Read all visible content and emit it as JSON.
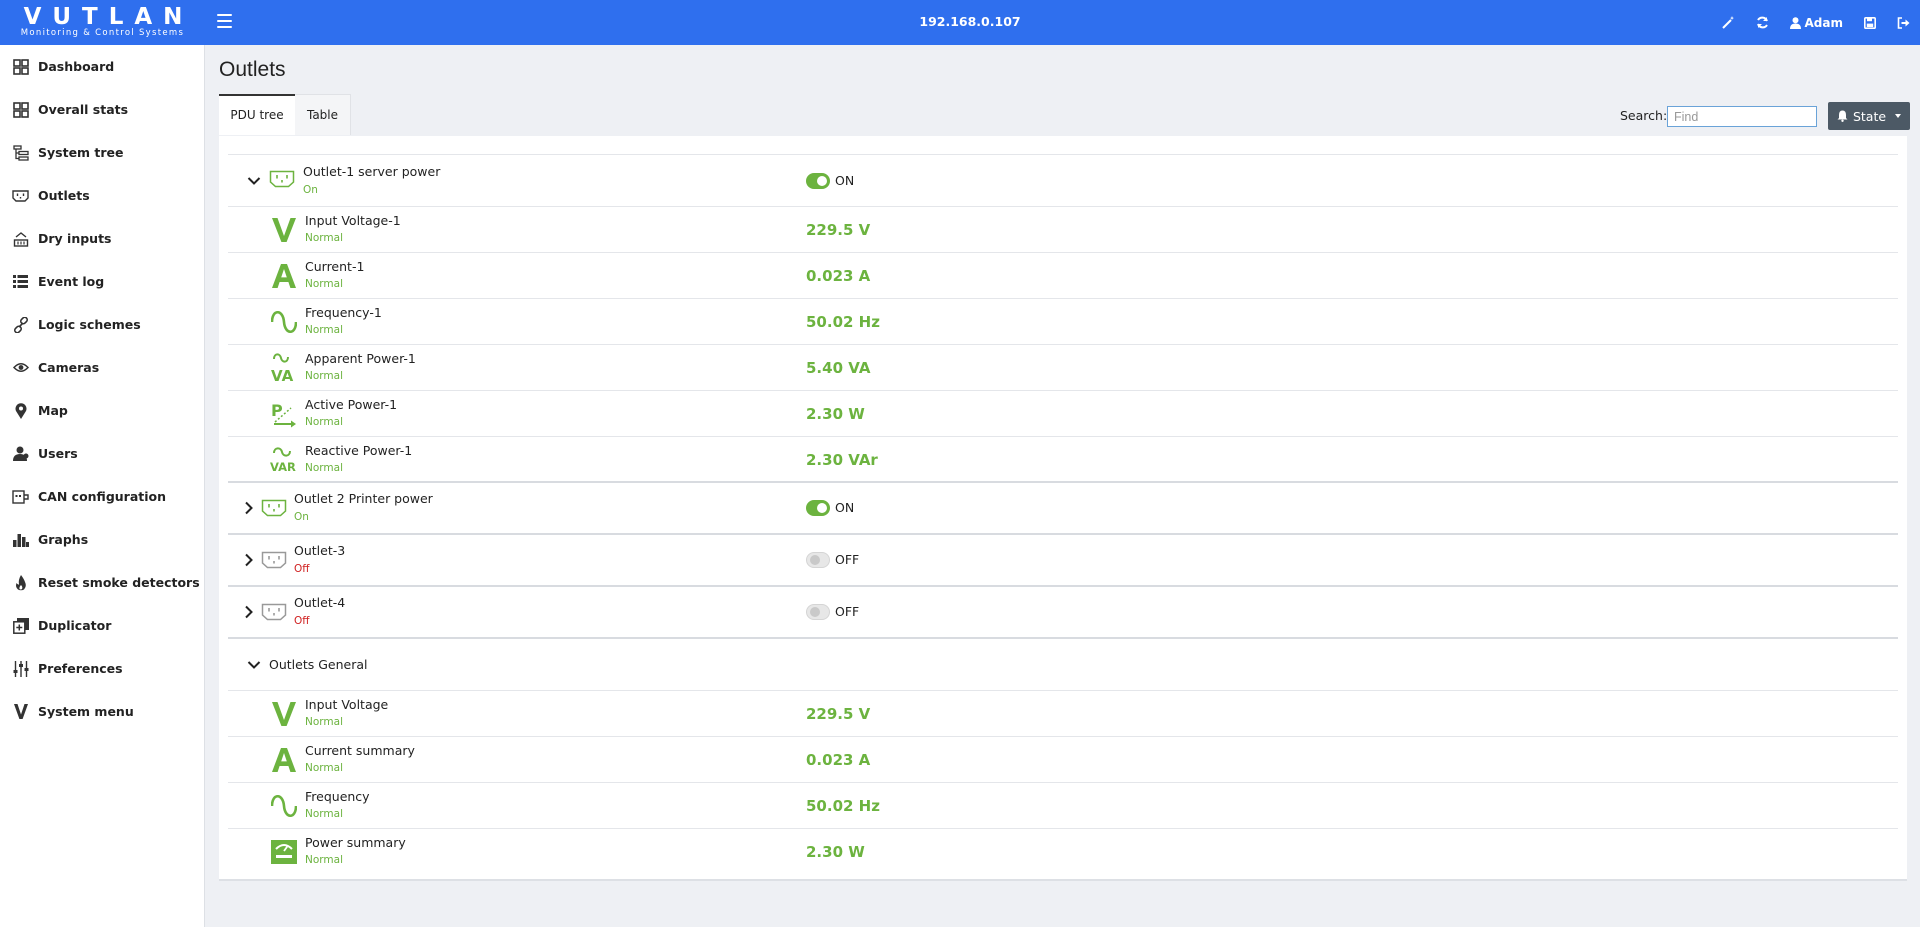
{
  "header": {
    "logo_main": "VUTLAN",
    "logo_sub": "Monitoring & Control Systems",
    "ip": "192.168.0.107",
    "user": "Adam",
    "icons": [
      "magic-wand-icon",
      "refresh-icon",
      "user-icon",
      "save-icon",
      "logout-icon"
    ]
  },
  "sidebar": {
    "items": [
      {
        "label": "Dashboard",
        "icon": "grid-icon"
      },
      {
        "label": "Overall stats",
        "icon": "grid-icon"
      },
      {
        "label": "System tree",
        "icon": "tree-icon"
      },
      {
        "label": "Outlets",
        "icon": "outlet-icon"
      },
      {
        "label": "Dry inputs",
        "icon": "dry-input-icon"
      },
      {
        "label": "Event log",
        "icon": "list-icon"
      },
      {
        "label": "Logic schemes",
        "icon": "link-icon"
      },
      {
        "label": "Cameras",
        "icon": "eye-icon"
      },
      {
        "label": "Map",
        "icon": "map-marker-icon"
      },
      {
        "label": "Users",
        "icon": "users-icon"
      },
      {
        "label": "CAN configuration",
        "icon": "can-icon"
      },
      {
        "label": "Graphs",
        "icon": "bar-chart-icon"
      },
      {
        "label": "Reset smoke detectors",
        "icon": "fire-icon"
      },
      {
        "label": "Duplicator",
        "icon": "duplicate-icon"
      },
      {
        "label": "Preferences",
        "icon": "sliders-icon"
      },
      {
        "label": "System menu",
        "icon": "vutlan-v-icon"
      }
    ]
  },
  "main": {
    "title": "Outlets",
    "tabs": [
      "PDU tree",
      "Table"
    ],
    "search_label": "Search:",
    "search_placeholder": "Find",
    "state_button": "State"
  },
  "outlet1": {
    "name": "Outlet-1 server power",
    "state": "On",
    "toggle": "ON",
    "sensors": [
      {
        "icon": "voltage-icon",
        "name": "Input Voltage-1",
        "status": "Normal",
        "value": "229.5 V"
      },
      {
        "icon": "current-icon",
        "name": "Current-1",
        "status": "Normal",
        "value": "0.023 A"
      },
      {
        "icon": "frequency-icon",
        "name": "Frequency-1",
        "status": "Normal",
        "value": "50.02 Hz"
      },
      {
        "icon": "apparent-power-icon",
        "name": "Apparent Power-1",
        "status": "Normal",
        "value": "5.40 VA"
      },
      {
        "icon": "active-power-icon",
        "name": "Active Power-1",
        "status": "Normal",
        "value": "2.30 W"
      },
      {
        "icon": "reactive-power-icon",
        "name": "Reactive Power-1",
        "status": "Normal",
        "value": "2.30 VAr"
      }
    ]
  },
  "outlets_collapsed": [
    {
      "name": "Outlet 2 Printer power",
      "state": "On",
      "toggle": "ON"
    },
    {
      "name": "Outlet-3",
      "state": "Off",
      "toggle": "OFF"
    },
    {
      "name": "Outlet-4",
      "state": "Off",
      "toggle": "OFF"
    }
  ],
  "general": {
    "title": "Outlets General",
    "sensors": [
      {
        "icon": "voltage-icon",
        "name": "Input Voltage",
        "status": "Normal",
        "value": "229.5 V"
      },
      {
        "icon": "current-icon",
        "name": "Current summary",
        "status": "Normal",
        "value": "0.023 A"
      },
      {
        "icon": "frequency-icon",
        "name": "Frequency",
        "status": "Normal",
        "value": "50.02 Hz"
      },
      {
        "icon": "power-summary-icon",
        "name": "Power summary",
        "status": "Normal",
        "value": "2.30 W"
      }
    ]
  },
  "colors": {
    "header": "#2f6fee",
    "green": "#6cb33f",
    "red": "#d02020",
    "state_button": "#4c5965"
  }
}
